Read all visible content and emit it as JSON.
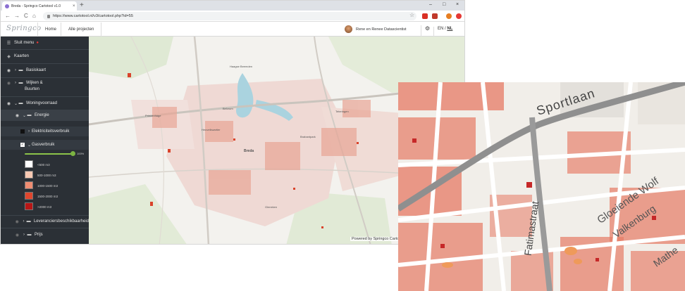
{
  "browser": {
    "tab_title": "Breda - Springco Cartotool v1.0",
    "tab_close": "×",
    "new_tab": "+",
    "min": "–",
    "max": "□",
    "close": "×",
    "back": "←",
    "forward": "→",
    "reload": "C",
    "home": "⌂",
    "url": "https://www.cartotool.nl/v3/cartotool.php?id=55",
    "star": "☆"
  },
  "header": {
    "logo": "Springco",
    "nav": [
      "Home",
      "Alle projecten"
    ],
    "user_name": "Rene en Renee Datascientist",
    "gear": "⚙",
    "lang_en": "EN",
    "lang_sep": "/",
    "lang_nl": "NL"
  },
  "sidebar": {
    "close_menu": "Sluit menu",
    "maps": "Kaarten",
    "items": {
      "basiskaart": "Basiskaart",
      "wijken_1": "Wijken &",
      "wijken_2": "Buurten",
      "woningvoorraad": "Woningvoorraad",
      "energie": "Energie",
      "elektriciteit": "Elektriciteitsverbruik",
      "gasverbruik": "Gasverbruik",
      "leveringszekerheid": "Leveranciersbeschikbaarheid",
      "prijs": "Prijs"
    },
    "slider_value": "100%",
    "slider_fraction": 1.0,
    "legend": [
      {
        "label": "<500 m3",
        "color": "#ffffff"
      },
      {
        "label": "500-1000 m3",
        "color": "#f7c9b3"
      },
      {
        "label": "1000-1500 m3",
        "color": "#ef8d72"
      },
      {
        "label": "1500-2000 m3",
        "color": "#e0462e"
      },
      {
        "label": ">2000 m3",
        "color": "#b71616"
      }
    ]
  },
  "map": {
    "labels": {
      "breda": "Breda",
      "teteringen": "Teteringen",
      "princenhage": "Princenhage",
      "ginneken": "Ginneken",
      "haagse_beemden": "Haagse Beemden",
      "heuvelkwartier": "Heuvelkwartier",
      "brabantpark": "Brabantpark",
      "belcrum": "Belcrum"
    },
    "attribution": "Powered by Springco Cartotool"
  },
  "inset": {
    "street_1": "Sportlaan",
    "street_2": "Gloeiende Wolf",
    "street_3": "Fatimastraat",
    "street_4": "Valkenburg",
    "street_5": "Mathe"
  }
}
